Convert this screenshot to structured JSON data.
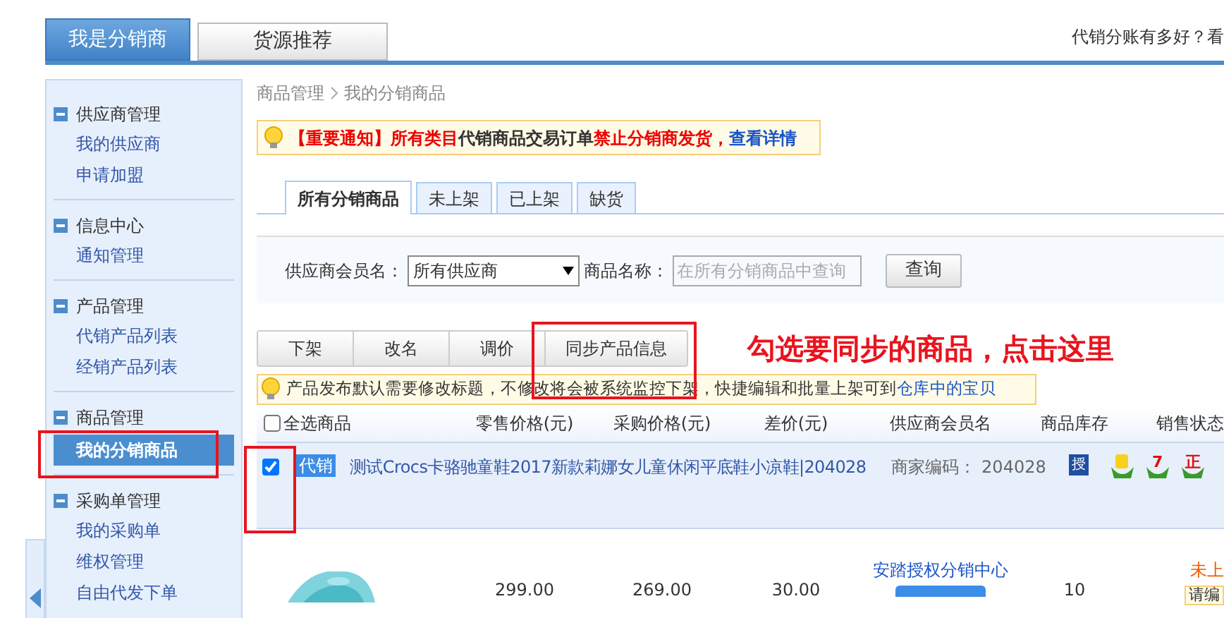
{
  "top_tabs": [
    {
      "label": "我是分销商",
      "selected": true
    },
    {
      "label": "货源推荐",
      "selected": false
    }
  ],
  "top_link": "代销分账有多好？看",
  "sidebar": {
    "groups": [
      {
        "title": "供应商管理",
        "expanded": true,
        "items": [
          {
            "label": "我的供应商",
            "selected": false
          },
          {
            "label": "申请加盟",
            "selected": false
          }
        ]
      },
      {
        "title": "信息中心",
        "expanded": true,
        "items": [
          {
            "label": "通知管理",
            "selected": false
          }
        ]
      },
      {
        "title": "产品管理",
        "expanded": true,
        "items": [
          {
            "label": "代销产品列表",
            "selected": false
          },
          {
            "label": "经销产品列表",
            "selected": false
          }
        ]
      },
      {
        "title": "商品管理",
        "expanded": true,
        "items": [
          {
            "label": "我的分销商品",
            "selected": true
          }
        ]
      },
      {
        "title": "采购单管理",
        "expanded": true,
        "items": [
          {
            "label": "我的采购单",
            "selected": false
          },
          {
            "label": "维权管理",
            "selected": false
          },
          {
            "label": "自由代发下单",
            "selected": false
          }
        ]
      }
    ]
  },
  "breadcrumb": [
    "商品管理",
    "我的分销商品"
  ],
  "notice": [
    {
      "kind": "alert",
      "text": "【重要通知】所有类目"
    },
    {
      "kind": "normal",
      "text": "代销商品交易订单"
    },
    {
      "kind": "alert",
      "text": "禁止分销商发货，"
    },
    {
      "kind": "link",
      "text": "查看详情"
    }
  ],
  "content_tabs": [
    {
      "label": "所有分销商品",
      "selected": true
    },
    {
      "label": "未上架",
      "selected": false
    },
    {
      "label": "已上架",
      "selected": false
    },
    {
      "label": "缺货",
      "selected": false
    }
  ],
  "filter": {
    "supplier_label": "供应商会员名：",
    "supplier_value": "所有供应商",
    "name_label": "商品名称：",
    "name_placeholder": "在所有分销商品中查询",
    "search_button": "查询"
  },
  "action_buttons": [
    "下架",
    "改名",
    "调价",
    "同步产品信息"
  ],
  "annotation": "勾选要同步的商品，点击这里",
  "tip": {
    "text": "产品发布默认需要修改标题，不修改将会被系统监控下架，快捷编辑和批量上架可到",
    "link": "仓库中的宝贝"
  },
  "select_all": {
    "label": "全选商品",
    "checked": false
  },
  "columns": [
    "零售价格(元)",
    "采购价格(元)",
    "差价(元)",
    "供应商会员名",
    "商品库存",
    "销售状态"
  ],
  "rows": [
    {
      "checked": true,
      "tag": "代销",
      "title": "测试Crocs卡骆驰童鞋2017新款莉娜女儿童休闲平底鞋小凉鞋|204028",
      "merchant_code": "商家编码： 204028",
      "auth_badge": "授",
      "service_badges": [
        {
          "kind": "plain"
        },
        {
          "kind": "text",
          "text": "7"
        },
        {
          "kind": "text",
          "text": "正"
        }
      ],
      "retail": "299.00",
      "purchase": "269.00",
      "diff": "30.00",
      "supplier": "安踏授权分销中心",
      "stock": "10",
      "status": "未上",
      "status_hint": "请编"
    }
  ]
}
